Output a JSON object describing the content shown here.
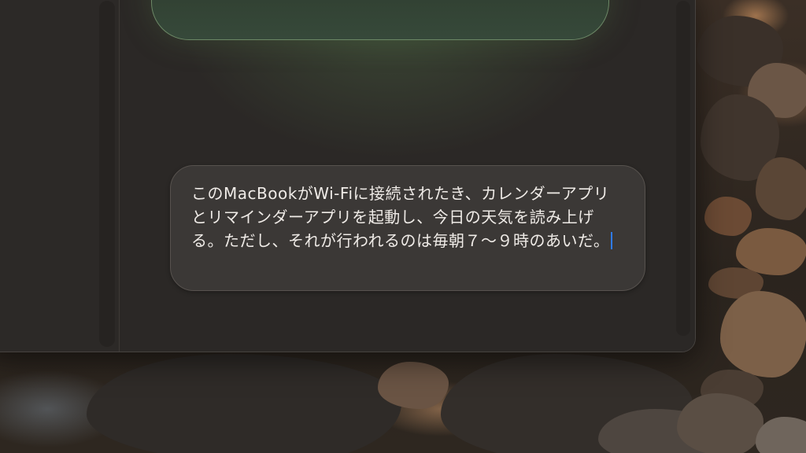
{
  "prompt": {
    "text": "このMacBookがWi-Fiに接続されたき、カレンダーアプリとリマインダーアプリを起動し、今日の天気を読み上げる。ただし、それが行われるのは毎朝７〜９時のあいだ。",
    "caret_color": "#2f7bf5"
  },
  "colors": {
    "window_bg": "#2b2826",
    "bubble_bg": "#3b3836",
    "card_border": "#6c8866",
    "text": "#efebe7"
  }
}
